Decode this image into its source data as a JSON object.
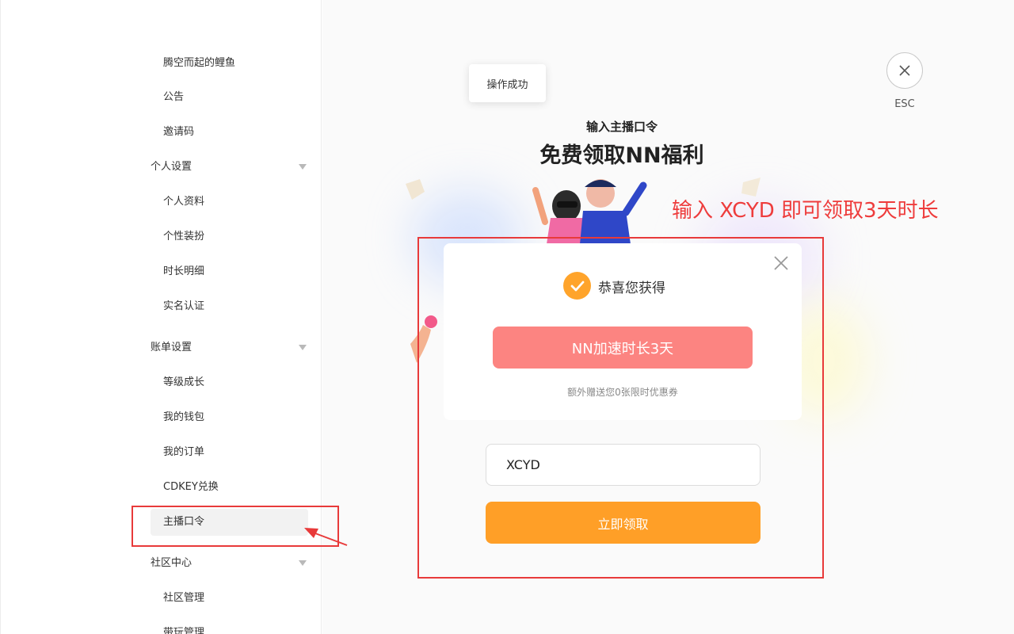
{
  "sidebar": {
    "items": [
      {
        "label": "腾空而起的鲤鱼",
        "type": "sub"
      },
      {
        "label": "公告",
        "type": "sub"
      },
      {
        "label": "邀请码",
        "type": "sub"
      },
      {
        "label": "个人设置",
        "type": "group"
      },
      {
        "label": "个人资料",
        "type": "sub"
      },
      {
        "label": "个性装扮",
        "type": "sub"
      },
      {
        "label": "时长明细",
        "type": "sub"
      },
      {
        "label": "实名认证",
        "type": "sub"
      },
      {
        "label": "账单设置",
        "type": "group"
      },
      {
        "label": "等级成长",
        "type": "sub"
      },
      {
        "label": "我的钱包",
        "type": "sub"
      },
      {
        "label": "我的订单",
        "type": "sub"
      },
      {
        "label": "CDKEY兑换",
        "type": "sub"
      },
      {
        "label": "主播口令",
        "type": "sub",
        "active": true
      },
      {
        "label": "社区中心",
        "type": "group"
      },
      {
        "label": "社区管理",
        "type": "sub"
      },
      {
        "label": "带玩管理",
        "type": "sub"
      }
    ]
  },
  "toast": {
    "text": "操作成功"
  },
  "esc": {
    "label": "ESC"
  },
  "header": {
    "subtitle": "输入主播口令",
    "title": "免费领取NN福利"
  },
  "annotation": {
    "text": "输入 XCYD 即可领取3天时长",
    "color": "#ee3c3c"
  },
  "result": {
    "congrats": "恭喜您获得",
    "reward": "NN加速时长3天",
    "extra": "额外赠送您0张限时优惠券"
  },
  "form": {
    "code_value": "XCYD",
    "submit_label": "立即领取"
  },
  "colors": {
    "accent": "#ff9f27",
    "reward": "#fc8481",
    "annotation": "#e83a3a"
  }
}
